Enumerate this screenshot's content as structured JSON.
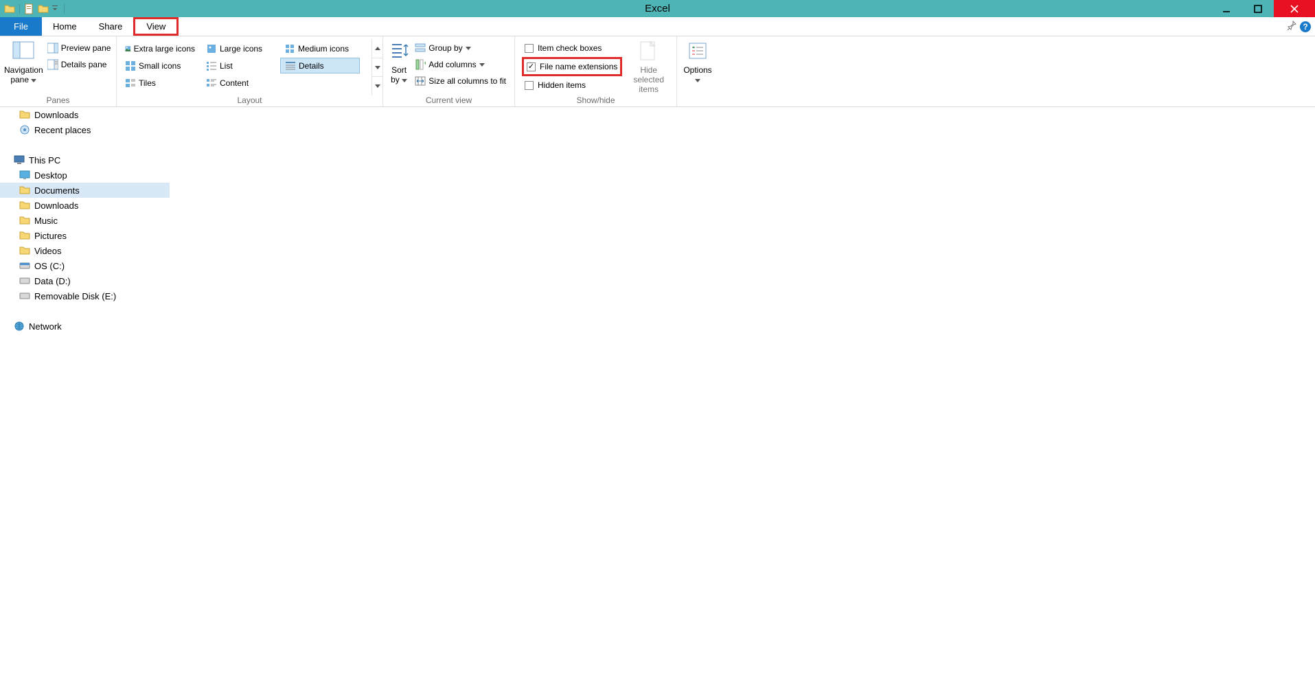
{
  "window": {
    "title": "Excel"
  },
  "tabs": {
    "file": "File",
    "home": "Home",
    "share": "Share",
    "view": "View"
  },
  "ribbon": {
    "panes": {
      "navigation": "Navigation pane",
      "preview": "Preview pane",
      "details": "Details pane",
      "label": "Panes"
    },
    "layout": {
      "xl": "Extra large icons",
      "large": "Large icons",
      "medium": "Medium icons",
      "small": "Small icons",
      "list": "List",
      "details": "Details",
      "tiles": "Tiles",
      "content": "Content",
      "label": "Layout"
    },
    "currentview": {
      "sortby": "Sort by",
      "groupby": "Group by",
      "addcolumns": "Add columns",
      "sizeall": "Size all columns to fit",
      "label": "Current view"
    },
    "showhide": {
      "itemcheck": "Item check boxes",
      "extensions": "File name extensions",
      "hidden": "Hidden items",
      "hidesel": "Hide selected items",
      "label": "Show/hide"
    },
    "options": "Options"
  },
  "nav": {
    "downloads": "Downloads",
    "recent": "Recent places",
    "thispc": "This PC",
    "desktop": "Desktop",
    "documents": "Documents",
    "downloads2": "Downloads",
    "music": "Music",
    "pictures": "Pictures",
    "videos": "Videos",
    "osc": "OS (C:)",
    "datad": "Data (D:)",
    "removable": "Removable Disk (E:)",
    "network": "Network"
  }
}
